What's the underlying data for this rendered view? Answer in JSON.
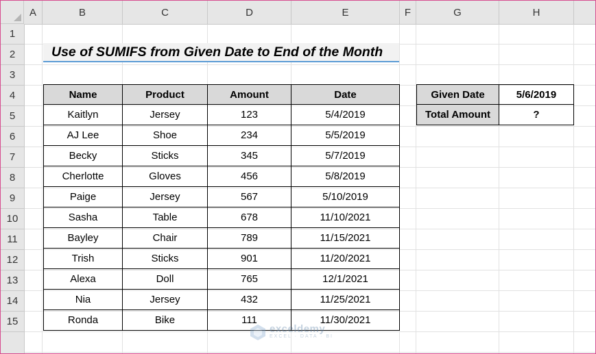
{
  "columns": [
    "A",
    "B",
    "C",
    "D",
    "E",
    "F",
    "G",
    "H"
  ],
  "rows": [
    "1",
    "2",
    "3",
    "4",
    "5",
    "6",
    "7",
    "8",
    "9",
    "10",
    "11",
    "12",
    "13",
    "14",
    "15"
  ],
  "title": "Use of SUMIFS from Given Date to End of the Month",
  "table": {
    "headers": [
      "Name",
      "Product",
      "Amount",
      "Date"
    ],
    "rows": [
      [
        "Kaitlyn",
        "Jersey",
        "123",
        "5/4/2019"
      ],
      [
        "AJ Lee",
        "Shoe",
        "234",
        "5/5/2019"
      ],
      [
        "Becky",
        "Sticks",
        "345",
        "5/7/2019"
      ],
      [
        "Cherlotte",
        "Gloves",
        "456",
        "5/8/2019"
      ],
      [
        "Paige",
        "Jersey",
        "567",
        "5/10/2019"
      ],
      [
        "Sasha",
        "Table",
        "678",
        "11/10/2021"
      ],
      [
        "Bayley",
        "Chair",
        "789",
        "11/15/2021"
      ],
      [
        "Trish",
        "Sticks",
        "901",
        "11/20/2021"
      ],
      [
        "Alexa",
        "Doll",
        "765",
        "12/1/2021"
      ],
      [
        "Nia",
        "Jersey",
        "432",
        "11/25/2021"
      ],
      [
        "Ronda",
        "Bike",
        "111",
        "11/30/2021"
      ]
    ]
  },
  "side": {
    "given_date_label": "Given Date",
    "given_date_value": "5/6/2019",
    "total_label": "Total Amount",
    "total_value": "?"
  },
  "watermark": {
    "name": "exceldemy",
    "sub": "EXCEL · DATA · BI"
  },
  "colors": {
    "header_fill": "#d9d9d9",
    "title_fill": "#f2f2f2",
    "title_underline": "#5b9bd5",
    "window_border": "#d64c8e"
  }
}
